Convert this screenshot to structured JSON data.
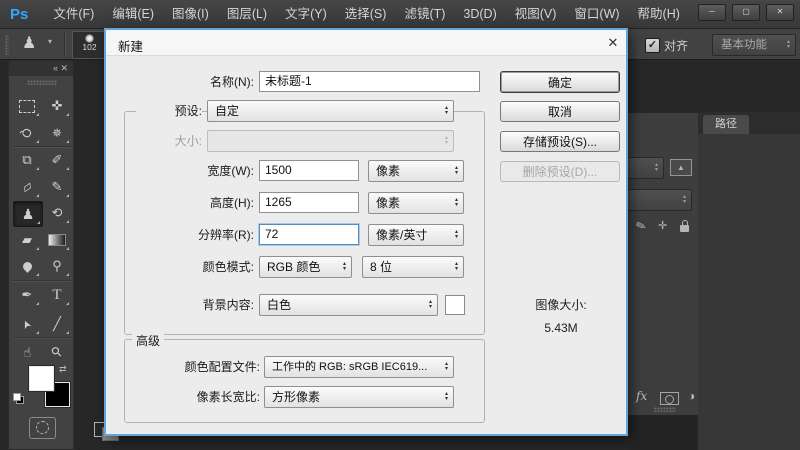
{
  "menu_bar": {
    "logo": "Ps",
    "items": [
      "文件(F)",
      "编辑(E)",
      "图像(I)",
      "图层(L)",
      "文字(Y)",
      "选择(S)",
      "滤镜(T)",
      "3D(D)",
      "视图(V)",
      "窗口(W)",
      "帮助(H)"
    ],
    "window_controls": {
      "minimize": "─",
      "maximize": "▢",
      "close": "✕"
    }
  },
  "options_bar": {
    "tool_glyph": "♟",
    "tool_dropdown_arrow": "▾",
    "brush_size": "102",
    "aligned": {
      "checked": true,
      "check_glyph": "✓",
      "label": "对齐"
    },
    "workspace_switcher": "基本功能"
  },
  "toolbox": {
    "collapse_glyph": "«  ✕",
    "swap_glyph": "⇄",
    "tools": [
      {
        "name": "rectangular-marquee",
        "glyph": ""
      },
      {
        "name": "move",
        "glyph": "✜"
      },
      {
        "name": "lasso",
        "glyph": "Q"
      },
      {
        "name": "magic-wand",
        "glyph": "✵"
      },
      {
        "name": "crop",
        "glyph": "⧉"
      },
      {
        "name": "eyedropper",
        "glyph": "✐"
      },
      {
        "name": "spot-healing-brush",
        "glyph": "▱"
      },
      {
        "name": "brush",
        "glyph": "✎"
      },
      {
        "name": "clone-stamp",
        "glyph": "♟",
        "selected": true
      },
      {
        "name": "history-brush",
        "glyph": "⟲"
      },
      {
        "name": "eraser",
        "glyph": "▰"
      },
      {
        "name": "gradient",
        "glyph": ""
      },
      {
        "name": "blur",
        "glyph": ""
      },
      {
        "name": "dodge",
        "glyph": "⚲"
      },
      {
        "name": "pen",
        "glyph": "✒"
      },
      {
        "name": "type",
        "glyph": "T"
      },
      {
        "name": "path-selection",
        "glyph": "➤"
      },
      {
        "name": "line",
        "glyph": "╱"
      },
      {
        "name": "hand",
        "glyph": "☜"
      },
      {
        "name": "zoom",
        "glyph": "⚲"
      }
    ]
  },
  "dialog": {
    "title": "新建",
    "close_glyph": "✕",
    "fields": {
      "name": {
        "label": "名称(N):",
        "value": "未标题-1"
      },
      "preset": {
        "label": "预设:",
        "value": "自定"
      },
      "size": {
        "label": "大小:",
        "value": ""
      },
      "width": {
        "label": "宽度(W):",
        "value": "1500",
        "unit": "像素"
      },
      "height": {
        "label": "高度(H):",
        "value": "1265",
        "unit": "像素"
      },
      "resolution": {
        "label": "分辨率(R):",
        "value": "72",
        "unit": "像素/英寸"
      },
      "color_mode": {
        "label": "颜色模式:",
        "value": "RGB 颜色",
        "depth": "8 位"
      },
      "background": {
        "label": "背景内容:",
        "value": "白色"
      },
      "advanced": "高级",
      "color_profile": {
        "label": "颜色配置文件:",
        "value": "工作中的 RGB: sRGB IEC619..."
      },
      "pixel_aspect": {
        "label": "像素长宽比:",
        "value": "方形像素"
      }
    },
    "buttons": {
      "ok": "确定",
      "cancel": "取消",
      "save_preset": "存储预设(S)...",
      "delete_preset": "删除预设(D)..."
    },
    "image_size": {
      "label": "图像大小:",
      "value": "5.43M"
    }
  },
  "panels": {
    "layers_strip": {
      "fx": "fx",
      "thumb_glyph": "▲",
      "brush_glyph": "✎",
      "move_glyph": "✛",
      "half_circle": "◑"
    },
    "paths": {
      "tab": "路径"
    }
  },
  "colors": {
    "logo_blue": "#31a8ff",
    "dialog_border": "#66a3d8",
    "focus_border": "#4a90c8"
  }
}
